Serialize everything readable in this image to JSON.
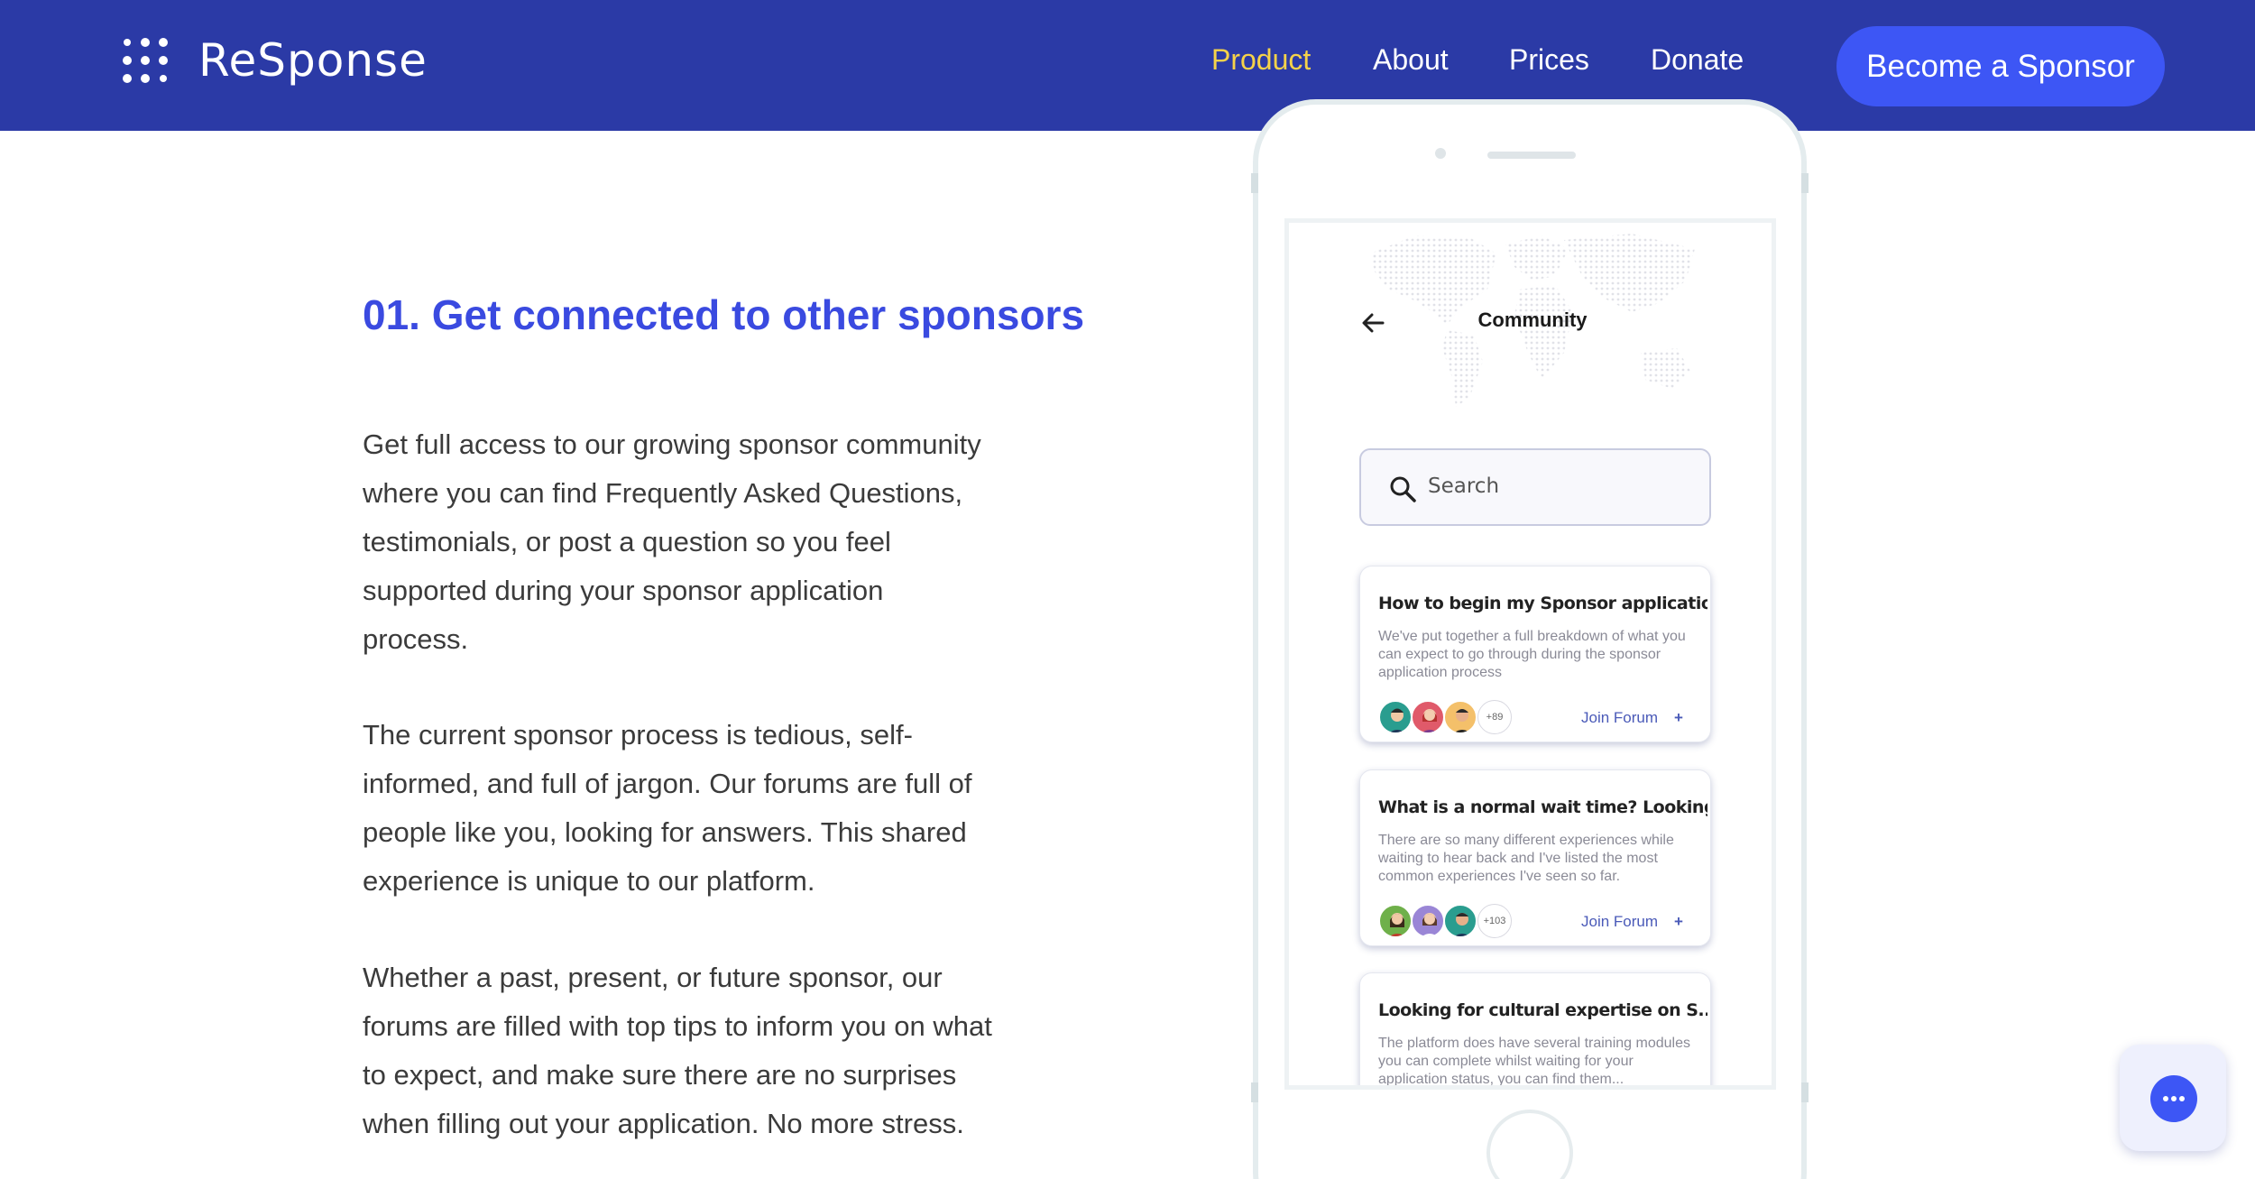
{
  "brand": {
    "name": "ReSponse"
  },
  "nav": {
    "items": [
      {
        "label": "Product",
        "active": true
      },
      {
        "label": "About",
        "active": false
      },
      {
        "label": "Prices",
        "active": false
      },
      {
        "label": "Donate",
        "active": false
      }
    ],
    "cta_label": "Become a Sponsor"
  },
  "colors": {
    "header_bg": "#2b3aa6",
    "accent": "#3d56f5",
    "active_nav": "#f5d24a",
    "title": "#3a4ae0"
  },
  "section": {
    "title": "01. Get connected to other sponsors",
    "paragraphs": [
      "Get full access to our growing sponsor community where you can find Frequently Asked Questions, testimonials, or post a question so you feel supported during your sponsor application process.",
      "The current sponsor process is tedious, self-informed, and full of jargon. Our forums are full of people like you, looking for answers. This shared experience is unique to our platform.",
      "Whether a past, present, or future sponsor, our forums are filled with top tips to inform you on what to expect, and make sure there are no surprises when filling out your application. No more stress."
    ]
  },
  "phone": {
    "screen_title": "Community",
    "search_placeholder": "Search",
    "cards": [
      {
        "title": "How to begin my Sponsor application?",
        "body": "We've put together a full breakdown of what you can expect to go through during the sponsor application process",
        "count": "+89",
        "action": "Join Forum",
        "avatars": [
          "#2a9d8f",
          "#e05a6a",
          "#f4c06a"
        ]
      },
      {
        "title": "What is a normal wait time? Looking f..",
        "body": "There are so many different experiences while waiting to hear back and I've listed the most common experiences I've seen so far.",
        "count": "+103",
        "action": "Join Forum",
        "avatars": [
          "#6fb04a",
          "#9a86d6",
          "#2a9d8f"
        ]
      },
      {
        "title": "Looking for cultural expertise on S..",
        "body": "The platform does have several training modules you can complete whilst waiting for your application status, you can find them..."
      }
    ]
  },
  "chat": {
    "icon": "chat-bubble-icon"
  }
}
